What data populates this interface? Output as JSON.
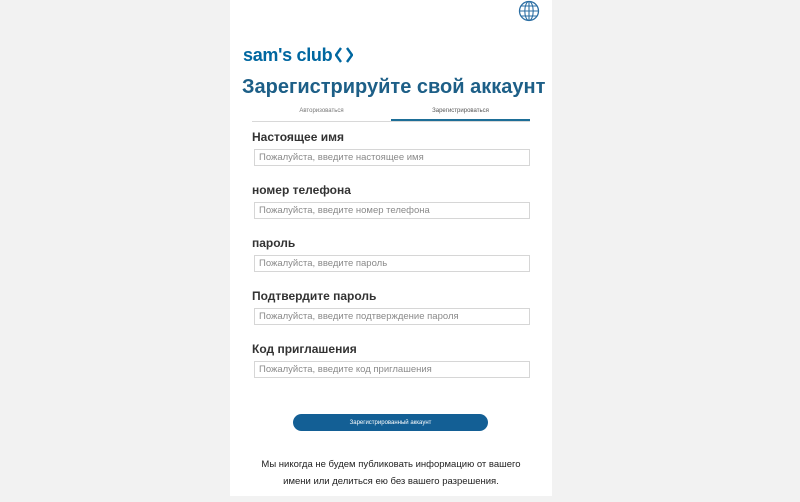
{
  "header": {
    "language_icon": "globe-icon"
  },
  "brand": {
    "logo_text": "sam's club",
    "logo_icon": "diamond-chevron-icon",
    "color": "#0067a0"
  },
  "title": "Зарегистрируйте свой аккаунт",
  "tabs": [
    {
      "label": "Авторизоваться",
      "active": false
    },
    {
      "label": "Зарегистрироваться",
      "active": true
    }
  ],
  "form": {
    "fields": [
      {
        "label": "Настоящее имя",
        "placeholder": "Пожалуйста, введите настоящее имя",
        "value": ""
      },
      {
        "label": "номер телефона",
        "placeholder": "Пожалуйста, введите номер телефона",
        "value": ""
      },
      {
        "label": "пароль",
        "placeholder": "Пожалуйста, введите пароль",
        "value": ""
      },
      {
        "label": "Подтвердите пароль",
        "placeholder": "Пожалуйста, введите подтверждение пароля",
        "value": ""
      },
      {
        "label": "Код приглашения",
        "placeholder": "Пожалуйста, введите код приглашения",
        "value": ""
      }
    ],
    "submit_label": "Зарегистрированный аккаунт"
  },
  "disclaimer": "Мы никогда не будем публиковать информацию от вашего имени или делиться ею без вашего разрешения.",
  "colors": {
    "accent": "#135f95",
    "title": "#1d5f87",
    "background": "#f2f2f2"
  }
}
